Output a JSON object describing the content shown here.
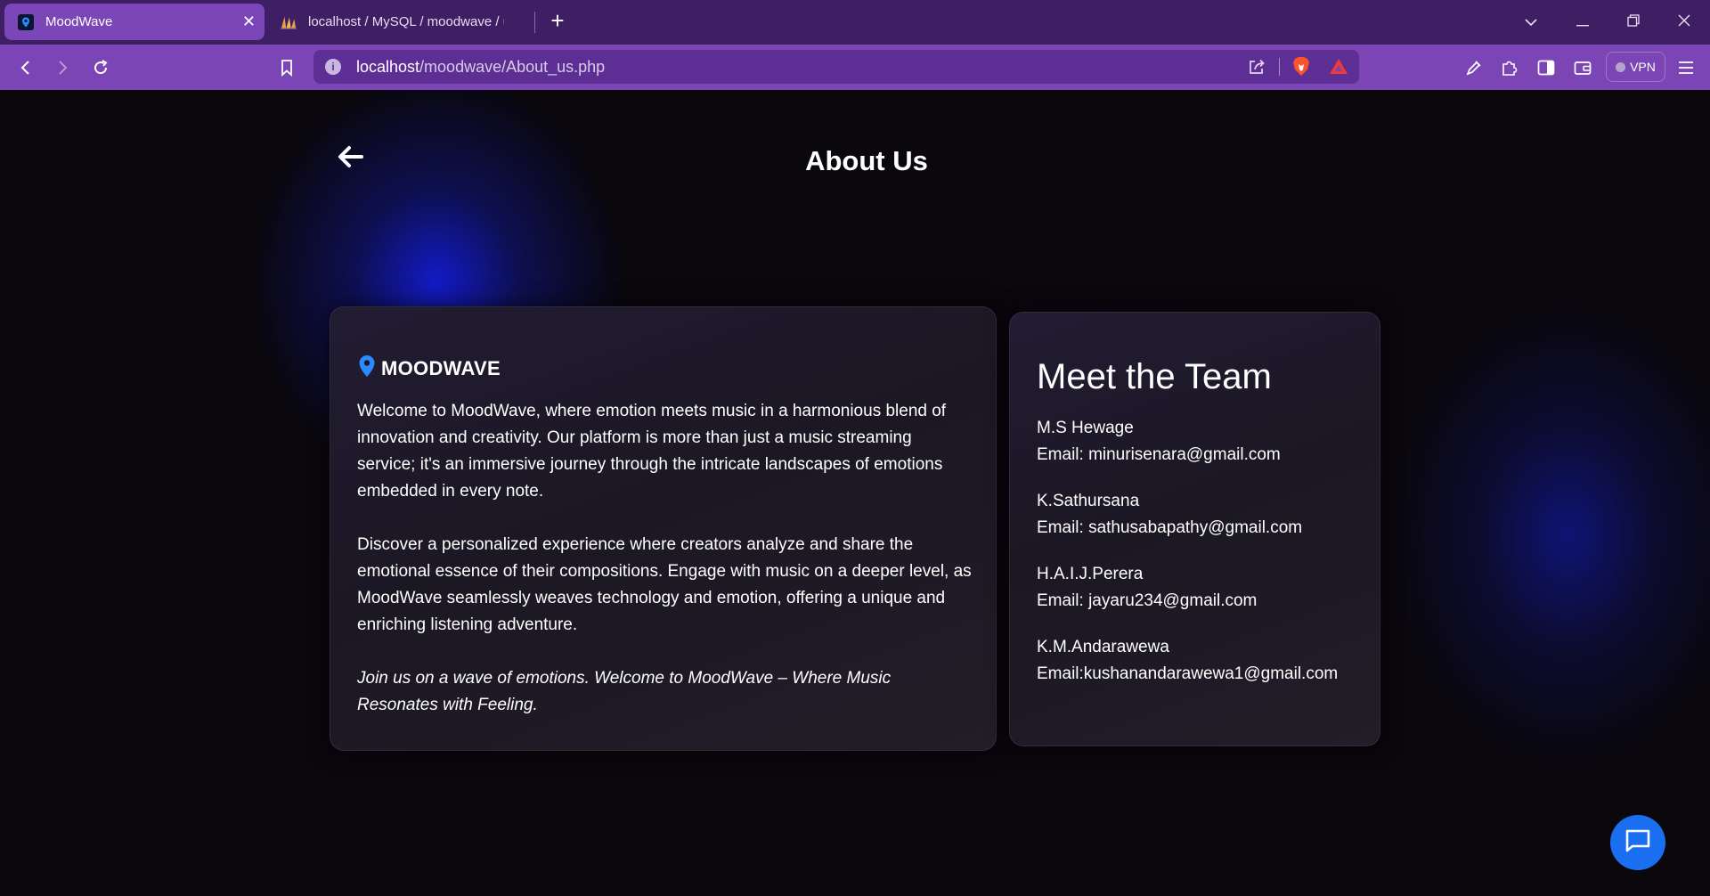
{
  "browser": {
    "tabs": [
      {
        "title": "MoodWave",
        "active": true
      },
      {
        "title": "localhost / MySQL / moodwave / users",
        "active": false
      }
    ],
    "url_host": "localhost",
    "url_path": "/moodwave/About_us.php",
    "vpn_label": "VPN",
    "accent_color": "#7c45b5"
  },
  "page": {
    "title": "About Us",
    "brand": {
      "name": "MOODWAVE",
      "icon": "location-pin-icon"
    },
    "about_paragraphs": [
      "Welcome to MoodWave, where emotion meets music in a harmonious blend of innovation and creativity. Our platform is more than just a music streaming service; it's an immersive journey through the intricate landscapes of emotions embedded in every note.",
      "Discover a personalized experience where creators analyze and share the emotional essence of their compositions. Engage with music on a deeper level, as MoodWave seamlessly weaves technology and emotion, offering a unique and enriching listening adventure.",
      "Join us on a wave of emotions. Welcome to MoodWave – Where Music Resonates with Feeling."
    ],
    "team": {
      "title": "Meet the Team",
      "members": [
        {
          "name": "M.S Hewage",
          "email": "Email: minurisenara@gmail.com"
        },
        {
          "name": "K.Sathursana",
          "email": "Email: sathusabapathy@gmail.com"
        },
        {
          "name": "H.A.I.J.Perera",
          "email": "Email: jayaru234@gmail.com"
        },
        {
          "name": "K.M.Andarawewa",
          "email": "Email:kushanandarawewa1@gmail.com"
        }
      ]
    },
    "chat_button_color": "#1a6ff0"
  }
}
